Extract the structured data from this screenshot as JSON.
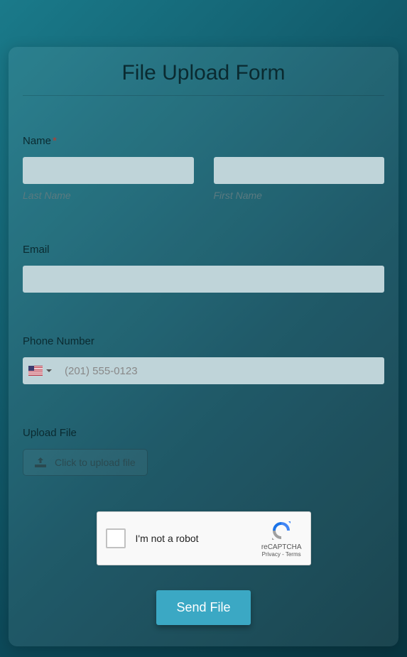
{
  "form": {
    "title": "File Upload Form",
    "name": {
      "label": "Name",
      "required": "*",
      "last_name_sub": "Last Name",
      "first_name_sub": "First Name"
    },
    "email": {
      "label": "Email"
    },
    "phone": {
      "label": "Phone Number",
      "placeholder": "(201) 555-0123"
    },
    "upload": {
      "label": "Upload File",
      "button_text": "Click to upload file"
    },
    "recaptcha": {
      "text": "I'm not a robot",
      "brand": "reCAPTCHA",
      "privacy": "Privacy",
      "terms": "Terms",
      "separator": " - "
    },
    "submit": {
      "label": "Send File"
    }
  }
}
